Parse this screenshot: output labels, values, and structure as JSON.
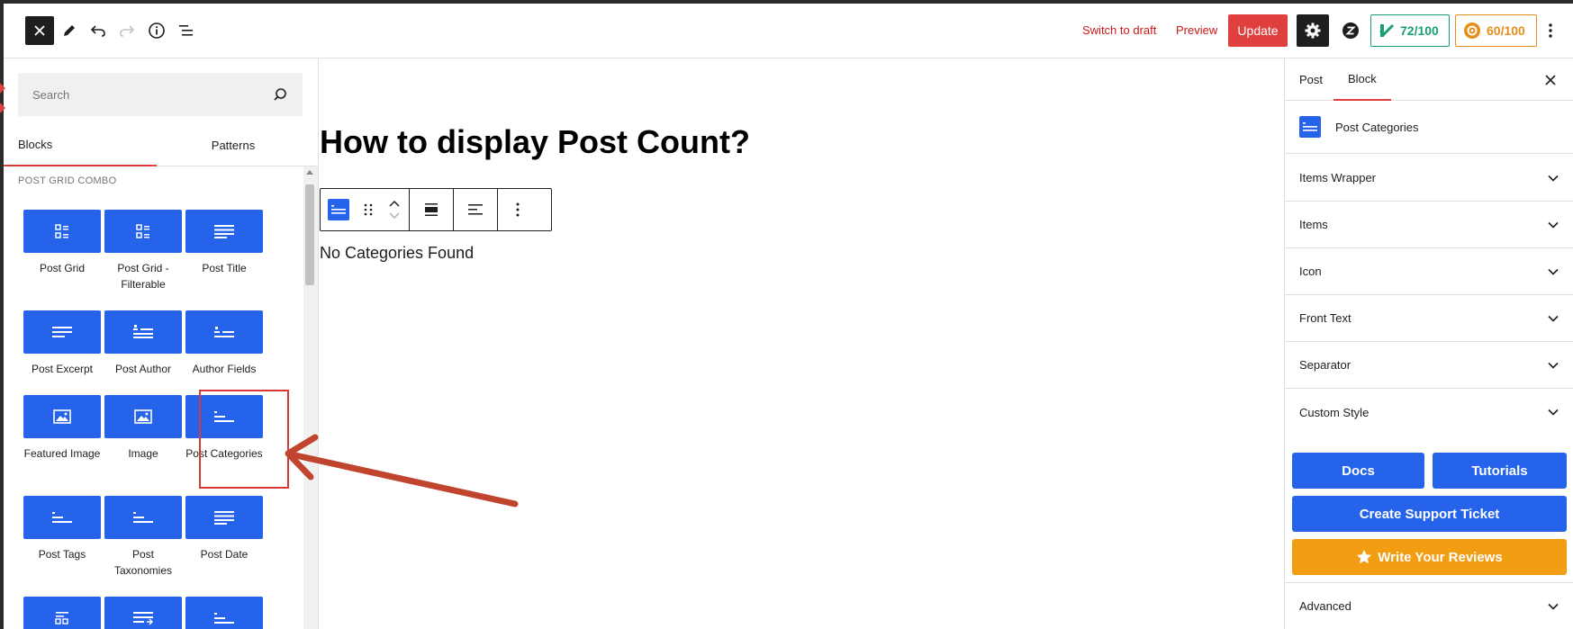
{
  "toolbar": {
    "switch_to_draft": "Switch to draft",
    "preview": "Preview",
    "update": "Update",
    "score_green": "72/100",
    "score_orange": "60/100"
  },
  "inserter": {
    "search_placeholder": "Search",
    "tabs": {
      "blocks": "Blocks",
      "patterns": "Patterns"
    },
    "category": "POST GRID COMBO",
    "blocks": [
      {
        "label": "Post Grid",
        "icon": "grid-icon"
      },
      {
        "label": "Post Grid - Filterable",
        "icon": "grid-icon"
      },
      {
        "label": "Post Title",
        "icon": "lines-icon"
      },
      {
        "label": "Post Excerpt",
        "icon": "lines-icon"
      },
      {
        "label": "Post Author",
        "icon": "author-icon"
      },
      {
        "label": "Author Fields",
        "icon": "author-fields-icon"
      },
      {
        "label": "Featured Image",
        "icon": "image-icon"
      },
      {
        "label": "Image",
        "icon": "image-icon"
      },
      {
        "label": "Post Categories",
        "icon": "categories-icon"
      },
      {
        "label": "Post Tags",
        "icon": "tags-icon"
      },
      {
        "label": "Post Taxonomies",
        "icon": "tags-icon"
      },
      {
        "label": "Post Date",
        "icon": "lines-icon"
      }
    ]
  },
  "editor": {
    "title": "How to display Post Count?",
    "block_message": "No Categories Found"
  },
  "sidebar": {
    "tabs": {
      "post": "Post",
      "block": "Block"
    },
    "block_name": "Post Categories",
    "panels": [
      "Items Wrapper",
      "Items",
      "Icon",
      "Front Text",
      "Separator",
      "Custom Style"
    ],
    "buttons": {
      "docs": "Docs",
      "tutorials": "Tutorials",
      "support": "Create Support Ticket",
      "reviews": "Write Your Reviews"
    },
    "advanced": "Advanced"
  },
  "colors": {
    "accent_red": "#e0403d",
    "block_blue": "#2563eb",
    "review_orange": "#f29d12",
    "score_green": "#1aa06d",
    "score_orange": "#e58e1a",
    "annotation_arrow": "#c0442e"
  }
}
